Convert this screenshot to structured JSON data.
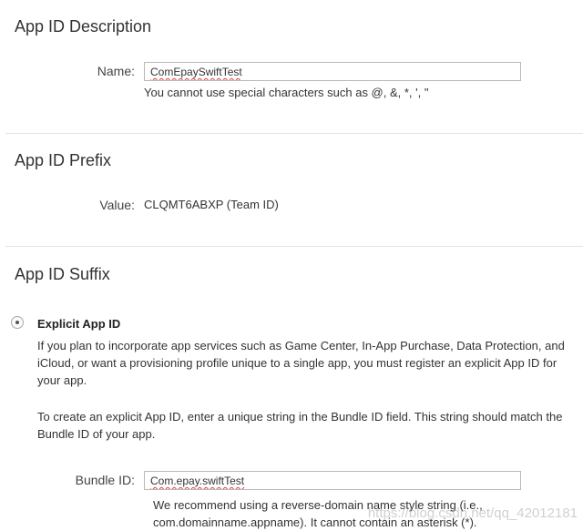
{
  "description": {
    "title": "App ID Description",
    "name_label": "Name:",
    "name_value": "ComEpaySwiftTest",
    "name_help": "You cannot use special characters such as @, &, *, ', \""
  },
  "prefix": {
    "title": "App ID Prefix",
    "value_label": "Value:",
    "value": "CLQMT6ABXP (Team ID)"
  },
  "suffix": {
    "title": "App ID Suffix",
    "explicit_label": "Explicit App ID",
    "explicit_selected": true,
    "explicit_desc_1": "If you plan to incorporate app services such as Game Center, In-App Purchase, Data Protection, and iCloud, or want a provisioning profile unique to a single app, you must register an explicit App ID for your app.",
    "explicit_desc_2": "To create an explicit App ID, enter a unique string in the Bundle ID field. This string should match the Bundle ID of your app.",
    "bundle_label": "Bundle ID:",
    "bundle_value": "Com.epay.swiftTest",
    "bundle_help": "We recommend using a reverse-domain name style string (i.e., com.domainname.appname). It cannot contain an asterisk (*)."
  },
  "watermark": "https://blog.csdn.net/qq_42012181"
}
